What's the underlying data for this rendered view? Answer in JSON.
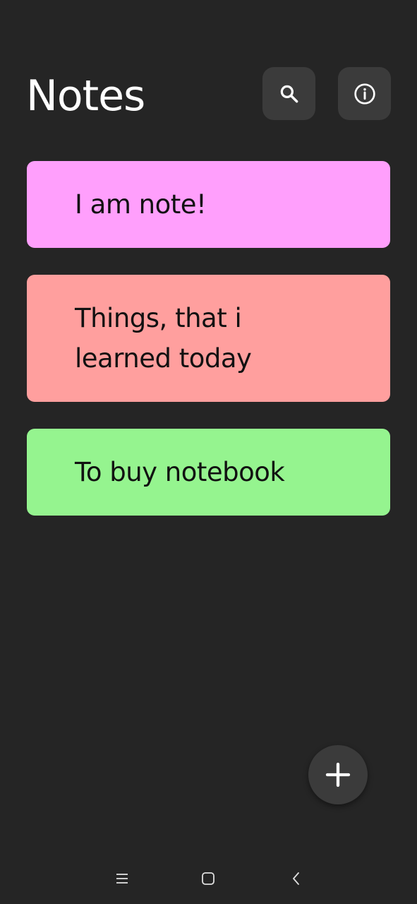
{
  "header": {
    "title": "Notes",
    "search_icon": "search-icon",
    "info_icon": "info-icon"
  },
  "notes": [
    {
      "text": "I am note!",
      "color": "#ff9ffc"
    },
    {
      "text": "Things, that i learned today",
      "color": "#ff9f9e"
    },
    {
      "text": "To buy notebook",
      "color": "#95f48f"
    }
  ],
  "fab": {
    "icon": "plus-icon"
  },
  "navbar": {
    "menu_icon": "menu-icon",
    "home_icon": "home-icon",
    "back_icon": "back-icon"
  },
  "colors": {
    "background": "#252525",
    "button": "#3b3b3b",
    "title_text": "#ffffff",
    "note_text": "#111111"
  }
}
